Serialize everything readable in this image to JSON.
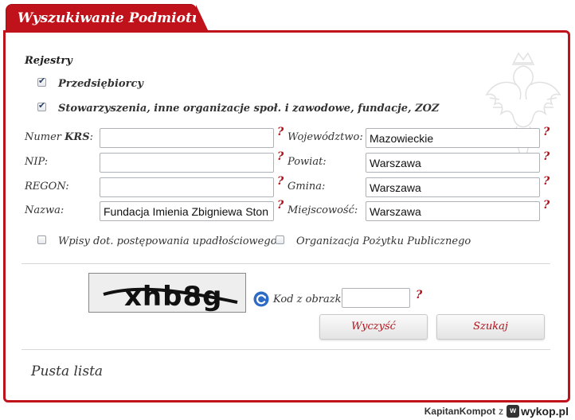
{
  "header": {
    "title": "Wyszukiwanie Podmiotu"
  },
  "registries": {
    "title": "Rejestry",
    "items": [
      {
        "label": "Przedsiębiorcy",
        "checked": true
      },
      {
        "label": "Stowarzyszenia, inne organizacje społ. i zawodowe, fundacje, ZOZ",
        "checked": true
      }
    ]
  },
  "fields_left": [
    {
      "label_prefix": "Numer ",
      "label_bold": "KRS",
      "label_suffix": ":",
      "value": ""
    },
    {
      "label_prefix": "NIP:",
      "label_bold": "",
      "label_suffix": "",
      "value": ""
    },
    {
      "label_prefix": "REGON:",
      "label_bold": "",
      "label_suffix": "",
      "value": ""
    },
    {
      "label_prefix": "Nazwa:",
      "label_bold": "",
      "label_suffix": "",
      "value": "Fundacja Imienia Zbigniewa Ston"
    }
  ],
  "fields_right": [
    {
      "label": "Województwo:",
      "value": "Mazowieckie"
    },
    {
      "label": "Powiat:",
      "value": "Warszawa"
    },
    {
      "label": "Gmina:",
      "value": "Warszawa"
    },
    {
      "label": "Miejscowość:",
      "value": "Warszawa"
    }
  ],
  "help_symbol": "?",
  "options": [
    {
      "label": "Wpisy dot. postępowania upadłościowego",
      "checked": false
    },
    {
      "label": "Organizacja Pożytku Publicznego",
      "checked": false
    }
  ],
  "captcha": {
    "text": "xhb8g",
    "label": "Kod z obrazka:",
    "value": ""
  },
  "buttons": {
    "clear": "Wyczyść",
    "search": "Szukaj"
  },
  "results": {
    "empty_text": "Pusta lista"
  },
  "footer": {
    "user": "KapitanKompot",
    "sep": "z",
    "site": "wykop.pl",
    "site_mark": "w"
  },
  "colors": {
    "accent": "#c0121b",
    "help": "#b0121a",
    "link": "#b0121a"
  },
  "icons": {
    "refresh": "refresh-icon",
    "eagle": "eagle-emblem",
    "check": "checkmark-icon"
  }
}
